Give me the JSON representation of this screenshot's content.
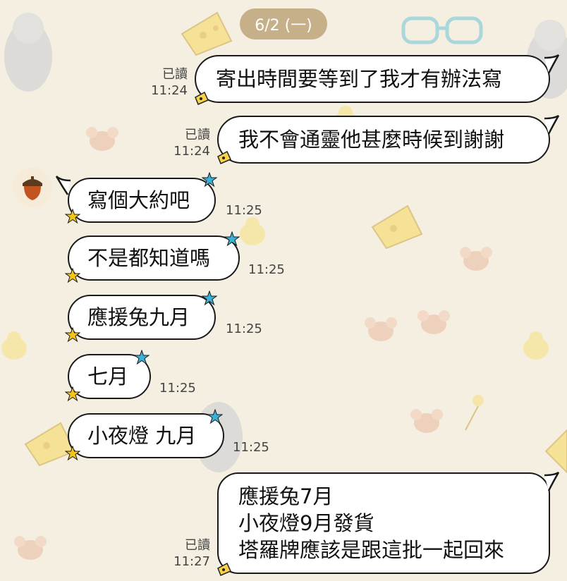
{
  "header": {
    "date": "6/2 (一)"
  },
  "messages": [
    {
      "side": "right",
      "text": "寄出時間要等到了我才有辦法寫",
      "read": "已讀",
      "time": "11:24"
    },
    {
      "side": "right",
      "text": "我不會通靈他甚麼時候到謝謝",
      "read": "已讀",
      "time": "11:24"
    },
    {
      "side": "left",
      "text": "寫個大約吧",
      "time": "11:25"
    },
    {
      "side": "left",
      "text": "不是都知道嗎",
      "time": "11:25"
    },
    {
      "side": "left",
      "text": "應援兔九月",
      "time": "11:25"
    },
    {
      "side": "left",
      "text": "七月",
      "time": "11:25"
    },
    {
      "side": "left",
      "text": "小夜燈 九月",
      "time": "11:25"
    },
    {
      "side": "right",
      "lines": [
        "應援兔7月",
        "小夜燈9月發貨",
        "塔羅牌應該是跟這批一起回來"
      ],
      "read": "已讀",
      "time": "11:27"
    }
  ],
  "icons": {
    "avatar": "acorn-icon",
    "right_badge": "cheese-icon",
    "left_decor": "star-icon"
  },
  "colors": {
    "background": "#f4efe1",
    "date_pill": "#c6b08a",
    "bubble_border": "#1a1a1a",
    "star_blue": "#3bb0d8",
    "star_yellow": "#f5c518"
  }
}
